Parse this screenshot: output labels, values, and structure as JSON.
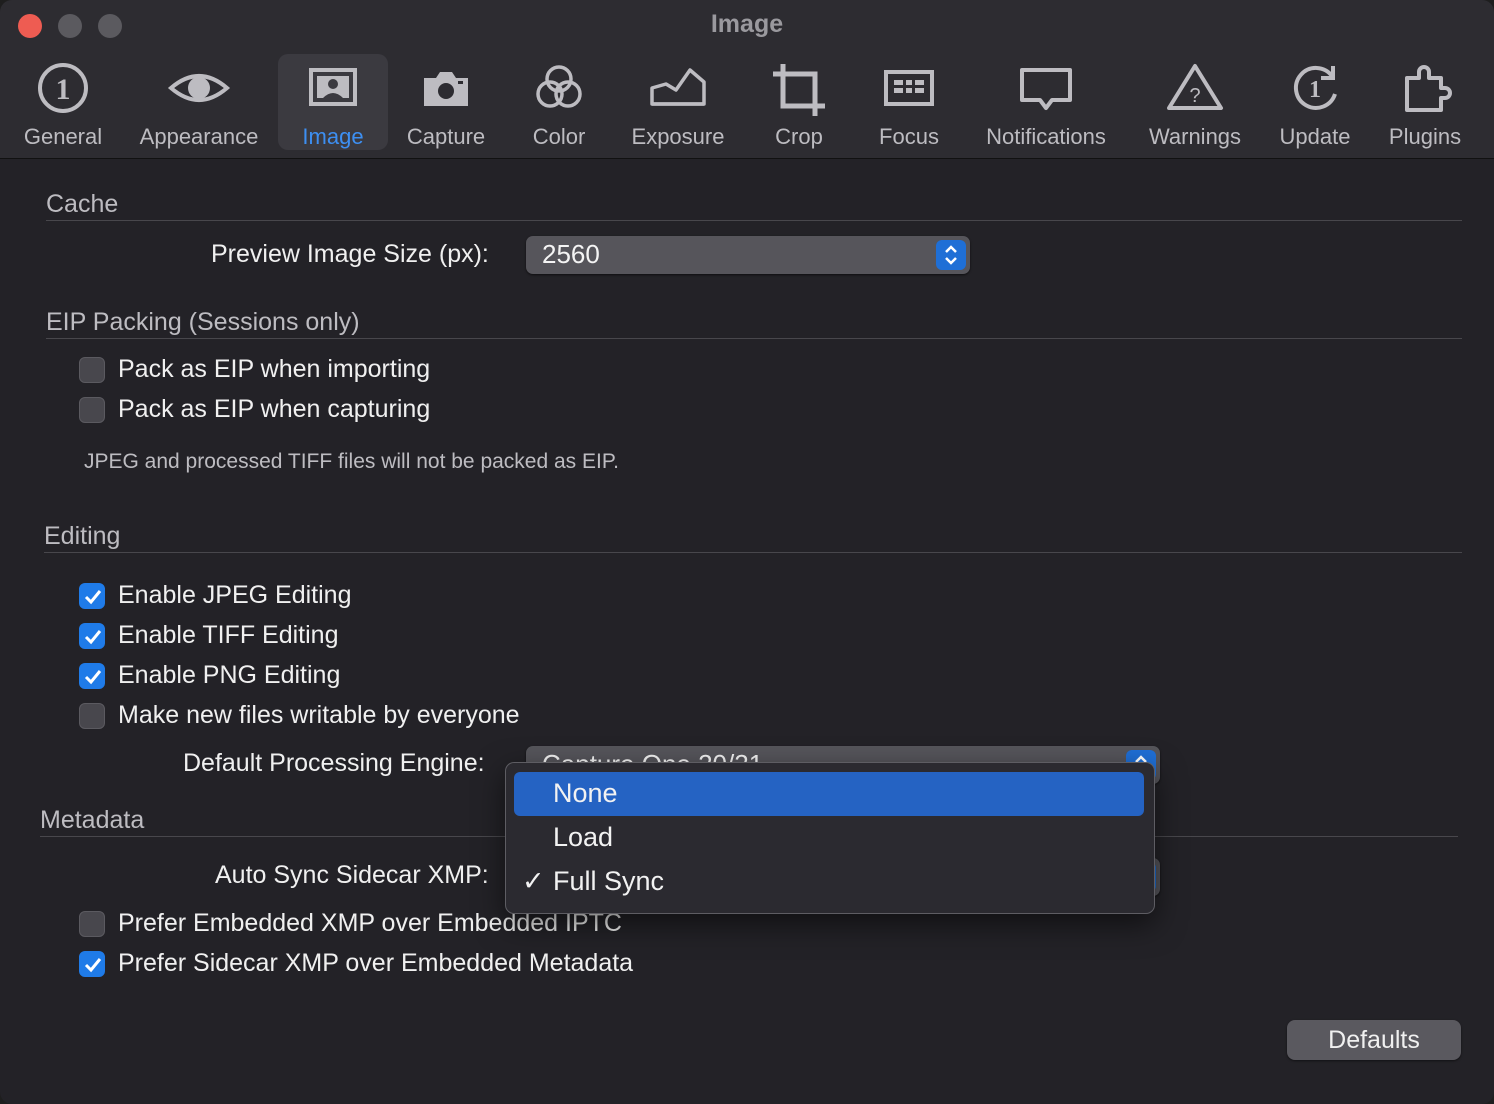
{
  "window": {
    "title": "Image"
  },
  "toolbar": {
    "items": [
      {
        "label": "General",
        "icon": "general-icon"
      },
      {
        "label": "Appearance",
        "icon": "eye-icon"
      },
      {
        "label": "Image",
        "icon": "image-icon",
        "selected": true
      },
      {
        "label": "Capture",
        "icon": "camera-icon"
      },
      {
        "label": "Color",
        "icon": "color-circles-icon"
      },
      {
        "label": "Exposure",
        "icon": "exposure-histogram-icon"
      },
      {
        "label": "Crop",
        "icon": "crop-icon"
      },
      {
        "label": "Focus",
        "icon": "focus-grid-icon"
      },
      {
        "label": "Notifications",
        "icon": "speech-bubble-icon"
      },
      {
        "label": "Warnings",
        "icon": "warning-triangle-icon"
      },
      {
        "label": "Update",
        "icon": "update-icon"
      },
      {
        "label": "Plugins",
        "icon": "puzzle-icon"
      }
    ]
  },
  "cache": {
    "title": "Cache",
    "preview_label": "Preview Image Size (px):",
    "preview_value": "2560"
  },
  "eip": {
    "title": "EIP Packing (Sessions only)",
    "items": [
      {
        "label": "Pack as EIP when importing",
        "checked": false
      },
      {
        "label": "Pack as EIP when capturing",
        "checked": false
      }
    ],
    "note": "JPEG and processed TIFF files will not be packed as EIP."
  },
  "editing": {
    "title": "Editing",
    "items": [
      {
        "label": "Enable JPEG Editing",
        "checked": true
      },
      {
        "label": "Enable TIFF Editing",
        "checked": true
      },
      {
        "label": "Enable PNG Editing",
        "checked": true
      },
      {
        "label": "Make new files writable by everyone",
        "checked": false
      }
    ],
    "engine_label": "Default Processing Engine:",
    "engine_value": "Capture One 20/21"
  },
  "metadata": {
    "title": "Metadata",
    "sync_label": "Auto Sync Sidecar XMP:",
    "sync_options": [
      {
        "label": "None",
        "highlighted": true,
        "checked": false
      },
      {
        "label": "Load",
        "highlighted": false,
        "checked": false
      },
      {
        "label": "Full Sync",
        "highlighted": false,
        "checked": true
      }
    ],
    "check_mark": "✓",
    "items": [
      {
        "label": "Prefer Embedded XMP over Embedded IPTC",
        "checked": false
      },
      {
        "label": "Prefer Sidecar XMP over Embedded Metadata",
        "checked": true
      }
    ]
  },
  "footer": {
    "defaults_label": "Defaults"
  },
  "colors": {
    "accent": "#1f7be8",
    "menu_highlight": "#2563c3",
    "selected_tab_text": "#3d8ff2"
  }
}
